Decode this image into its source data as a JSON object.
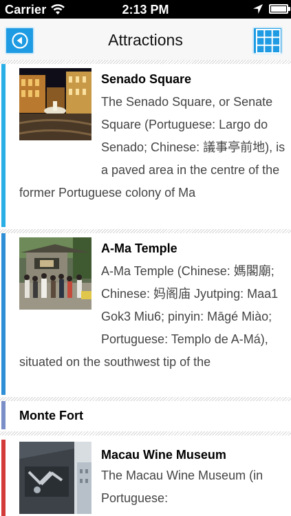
{
  "status_bar": {
    "carrier": "Carrier",
    "time": "2:13 PM"
  },
  "nav": {
    "title": "Attractions",
    "back_icon": "back-arrow-circle-icon",
    "grid_icon": "grid-menu-icon"
  },
  "colors": {
    "brand_blue": "#1e9be3",
    "accent_1": "#29aee6",
    "accent_2": "#2f8fd6",
    "accent_3": "#7a8ec8",
    "accent_4": "#d43a3a"
  },
  "attractions": [
    {
      "title": "Senado Square",
      "description": "The Senado Square, or Senate Square (Portuguese: Largo do Senado; Chinese: 議事亭前地), is a paved area in the centre of the former Portuguese colony of Ma"
    },
    {
      "title": "A-Ma Temple",
      "description": "A-Ma Temple (Chinese: 媽閣廟; Chinese: 妈阁庙 Jyutping: Maa1 Gok3 Miu6; pinyin: Māgé Miào; Portuguese: Templo de A-Má), situated on the southwest tip of the"
    },
    {
      "title": "Monte Fort",
      "description": ""
    },
    {
      "title": "Macau Wine Museum",
      "description": "The Macau Wine Museum (in Portuguese:"
    }
  ]
}
